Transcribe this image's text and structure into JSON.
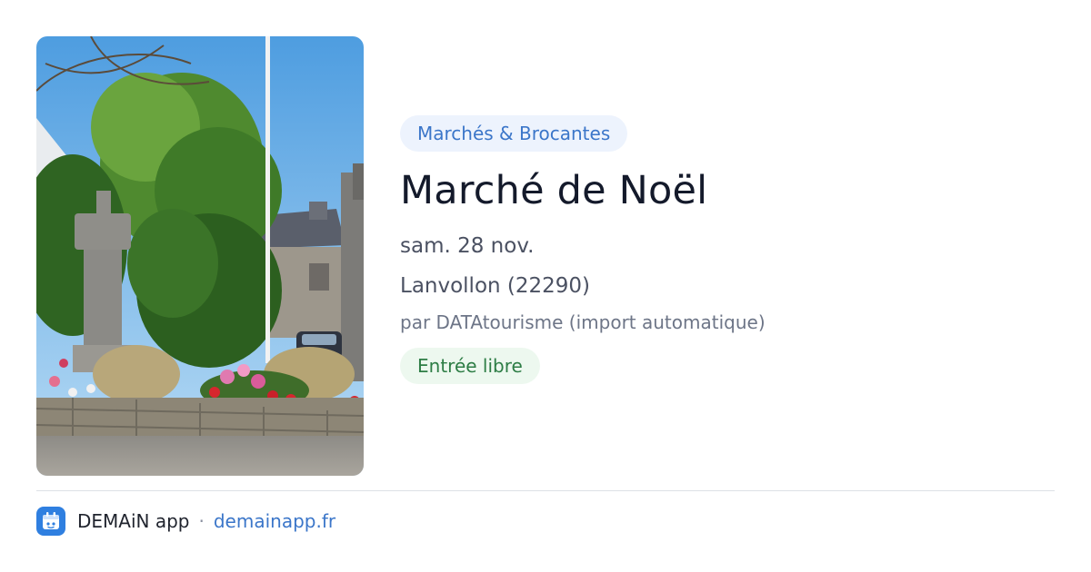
{
  "event": {
    "category": "Marchés & Brocantes",
    "title": "Marché de Noël",
    "date": "sam. 28 nov.",
    "location": "Lanvollon (22290)",
    "author": "par DATAtourisme (import automatique)",
    "price": "Entrée libre"
  },
  "footer": {
    "app_name": "DEMAiN app",
    "separator": "·",
    "url": "demainapp.fr"
  },
  "image": {
    "subject": "village-square-monument-photo"
  },
  "icons": {
    "app": "demain-app-icon"
  },
  "colors": {
    "category_chip_bg": "#edf3fd",
    "category_chip_text": "#3b76c9",
    "price_chip_bg": "#edf8ef",
    "price_chip_text": "#2d7d45",
    "title": "#141a2b",
    "link": "#3b76c9",
    "app_icon": "#2f7fe0"
  }
}
